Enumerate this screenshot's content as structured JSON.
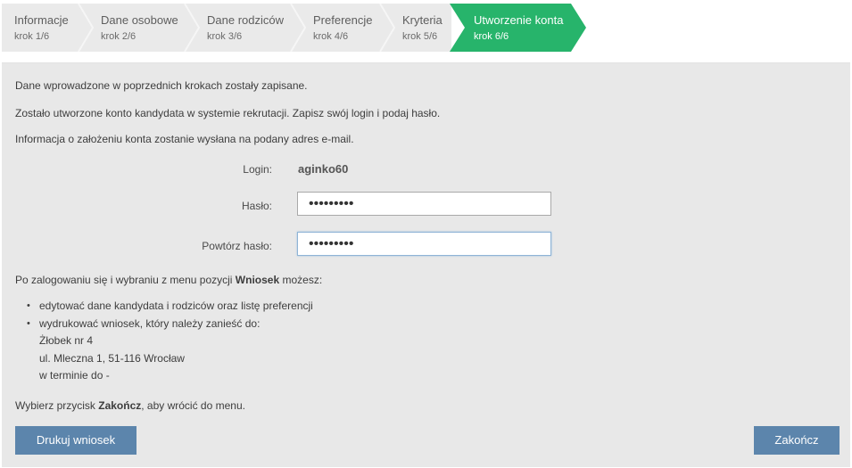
{
  "steps": [
    {
      "title": "Informacje",
      "subtitle": "krok 1/6"
    },
    {
      "title": "Dane osobowe",
      "subtitle": "krok 2/6"
    },
    {
      "title": "Dane rodziców",
      "subtitle": "krok 3/6"
    },
    {
      "title": "Preferencje",
      "subtitle": "krok 4/6"
    },
    {
      "title": "Kryteria",
      "subtitle": "krok 5/6"
    },
    {
      "title": "Utworzenie konta",
      "subtitle": "krok 6/6"
    }
  ],
  "active_step": 6,
  "colors": {
    "active_step": "#27b46b",
    "button": "#5c85ac",
    "panel": "#e8e8e8"
  },
  "messages": {
    "saved": "Dane wprowadzone w poprzednich krokach zostały zapisane.",
    "created": "Zostało utworzone konto kandydata w systemie rekrutacji. Zapisz swój login i podaj hasło.",
    "email_info": "Informacja o założeniu konta zostanie wysłana na podany adres e-mail."
  },
  "form": {
    "login_label": "Login:",
    "login_value": "aginko60",
    "password_label": "Hasło:",
    "password_value": "•••••••••",
    "password_confirm_label": "Powtórz hasło:",
    "password_confirm_value": "•••••••••"
  },
  "instructions": {
    "intro_before": "Po zalogowaniu się i wybraniu z menu pozycji ",
    "intro_bold": "Wniosek",
    "intro_after": " możesz:",
    "item1": "edytować dane kandydata i rodziców oraz listę preferencji",
    "item2": "wydrukować wniosek, który należy zanieść do:",
    "place": "Żłobek nr 4",
    "address": "ul. Mleczna 1, 51-116 Wrocław",
    "deadline": "w terminie do -",
    "finish_before": "Wybierz przycisk ",
    "finish_bold": "Zakończ",
    "finish_after": ", aby wrócić do menu."
  },
  "buttons": {
    "print": "Drukuj wniosek",
    "finish": "Zakończ"
  }
}
